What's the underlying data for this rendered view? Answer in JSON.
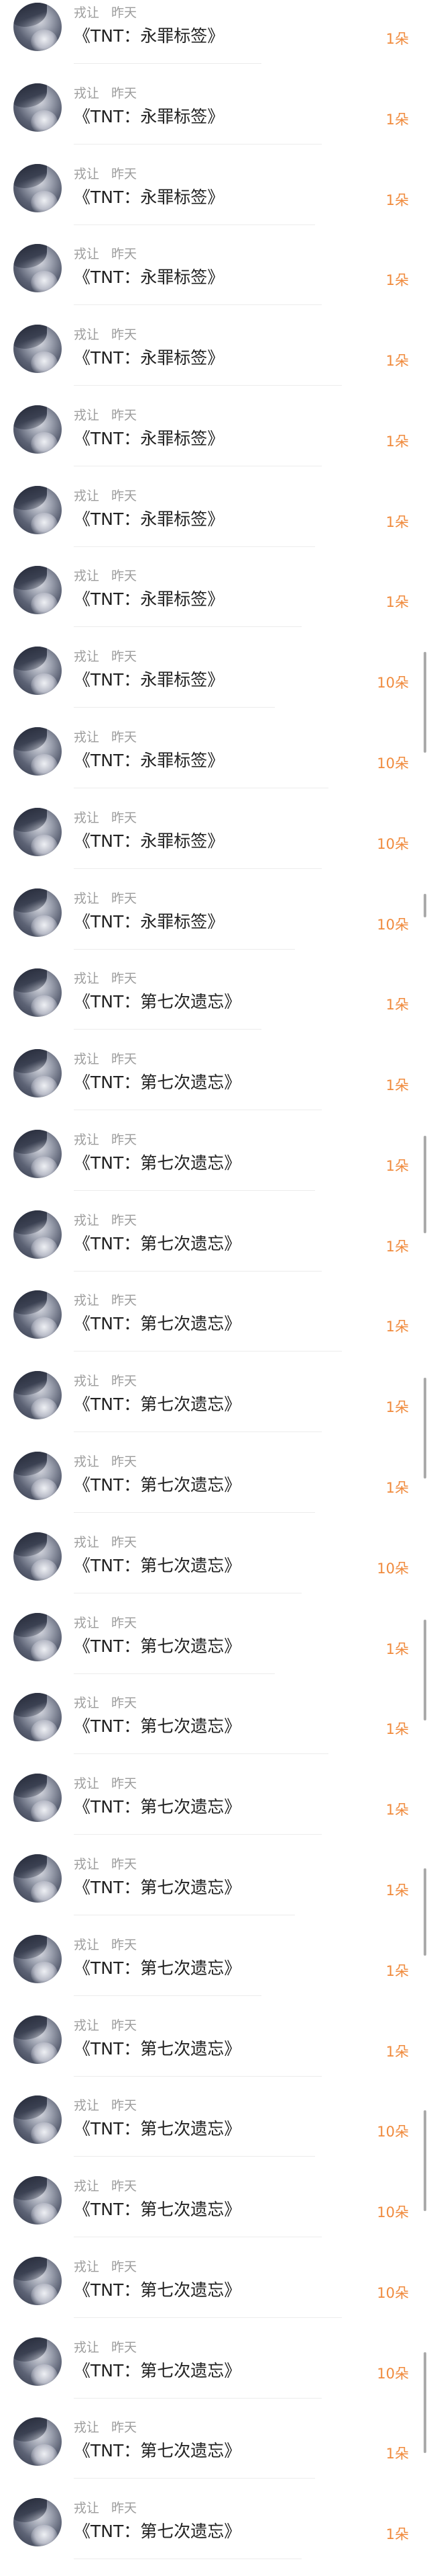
{
  "gifts": [
    {
      "sender": "戎让",
      "time": "昨天",
      "title": "《TNT：永罪标签》",
      "count": "1朵"
    },
    {
      "sender": "戎让",
      "time": "昨天",
      "title": "《TNT：永罪标签》",
      "count": "1朵"
    },
    {
      "sender": "戎让",
      "time": "昨天",
      "title": "《TNT：永罪标签》",
      "count": "1朵"
    },
    {
      "sender": "戎让",
      "time": "昨天",
      "title": "《TNT：永罪标签》",
      "count": "1朵"
    },
    {
      "sender": "戎让",
      "time": "昨天",
      "title": "《TNT：永罪标签》",
      "count": "1朵"
    },
    {
      "sender": "戎让",
      "time": "昨天",
      "title": "《TNT：永罪标签》",
      "count": "1朵"
    },
    {
      "sender": "戎让",
      "time": "昨天",
      "title": "《TNT：永罪标签》",
      "count": "1朵"
    },
    {
      "sender": "戎让",
      "time": "昨天",
      "title": "《TNT：永罪标签》",
      "count": "1朵"
    },
    {
      "sender": "戎让",
      "time": "昨天",
      "title": "《TNT：永罪标签》",
      "count": "10朵"
    },
    {
      "sender": "戎让",
      "time": "昨天",
      "title": "《TNT：永罪标签》",
      "count": "10朵"
    },
    {
      "sender": "戎让",
      "time": "昨天",
      "title": "《TNT：永罪标签》",
      "count": "10朵"
    },
    {
      "sender": "戎让",
      "time": "昨天",
      "title": "《TNT：永罪标签》",
      "count": "10朵"
    },
    {
      "sender": "戎让",
      "time": "昨天",
      "title": "《TNT：第七次遗忘》",
      "count": "1朵"
    },
    {
      "sender": "戎让",
      "time": "昨天",
      "title": "《TNT：第七次遗忘》",
      "count": "1朵"
    },
    {
      "sender": "戎让",
      "time": "昨天",
      "title": "《TNT：第七次遗忘》",
      "count": "1朵"
    },
    {
      "sender": "戎让",
      "time": "昨天",
      "title": "《TNT：第七次遗忘》",
      "count": "1朵"
    },
    {
      "sender": "戎让",
      "time": "昨天",
      "title": "《TNT：第七次遗忘》",
      "count": "1朵"
    },
    {
      "sender": "戎让",
      "time": "昨天",
      "title": "《TNT：第七次遗忘》",
      "count": "1朵"
    },
    {
      "sender": "戎让",
      "time": "昨天",
      "title": "《TNT：第七次遗忘》",
      "count": "1朵"
    },
    {
      "sender": "戎让",
      "time": "昨天",
      "title": "《TNT：第七次遗忘》",
      "count": "10朵"
    },
    {
      "sender": "戎让",
      "time": "昨天",
      "title": "《TNT：第七次遗忘》",
      "count": "1朵"
    },
    {
      "sender": "戎让",
      "time": "昨天",
      "title": "《TNT：第七次遗忘》",
      "count": "1朵"
    },
    {
      "sender": "戎让",
      "time": "昨天",
      "title": "《TNT：第七次遗忘》",
      "count": "1朵"
    },
    {
      "sender": "戎让",
      "time": "昨天",
      "title": "《TNT：第七次遗忘》",
      "count": "1朵"
    },
    {
      "sender": "戎让",
      "time": "昨天",
      "title": "《TNT：第七次遗忘》",
      "count": "1朵"
    },
    {
      "sender": "戎让",
      "time": "昨天",
      "title": "《TNT：第七次遗忘》",
      "count": "1朵"
    },
    {
      "sender": "戎让",
      "time": "昨天",
      "title": "《TNT：第七次遗忘》",
      "count": "10朵"
    },
    {
      "sender": "戎让",
      "time": "昨天",
      "title": "《TNT：第七次遗忘》",
      "count": "10朵"
    },
    {
      "sender": "戎让",
      "time": "昨天",
      "title": "《TNT：第七次遗忘》",
      "count": "10朵"
    },
    {
      "sender": "戎让",
      "time": "昨天",
      "title": "《TNT：第七次遗忘》",
      "count": "10朵"
    },
    {
      "sender": "戎让",
      "time": "昨天",
      "title": "《TNT：第七次遗忘》",
      "count": "1朵"
    },
    {
      "sender": "戎让",
      "time": "昨天",
      "title": "《TNT：第七次遗忘》",
      "count": "1朵"
    }
  ],
  "colors": {
    "count": "#f08a3c",
    "meta": "#9c9c9c",
    "title": "#222222"
  }
}
